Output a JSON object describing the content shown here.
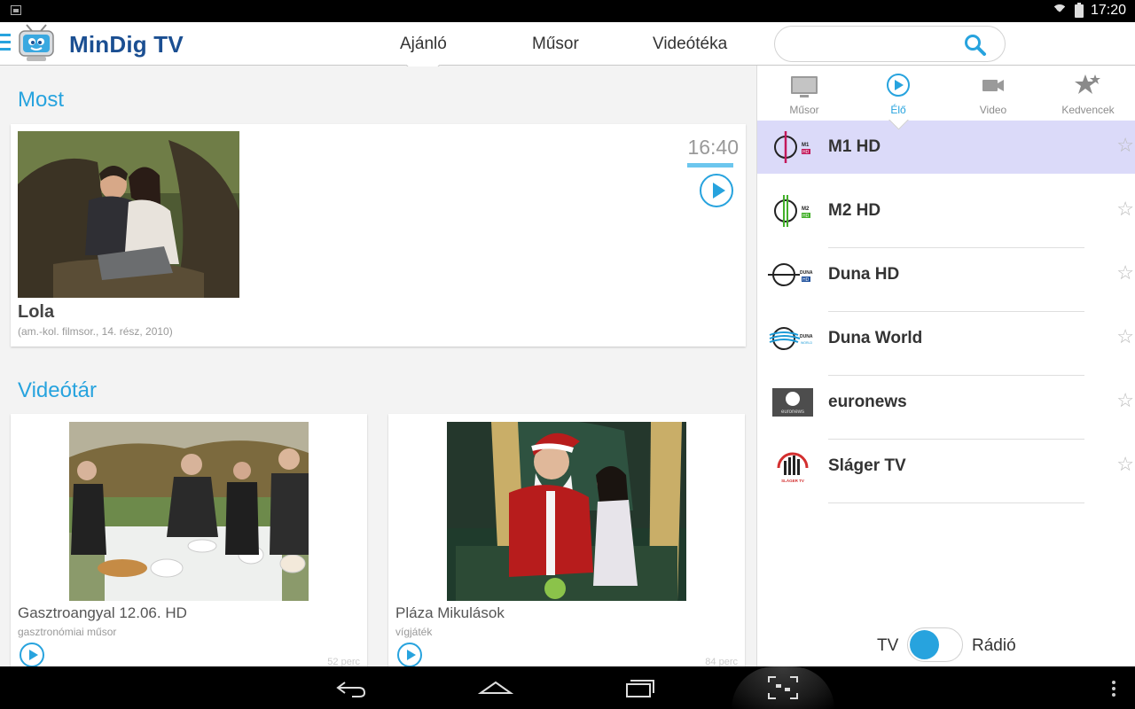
{
  "status_bar": {
    "time": "17:20"
  },
  "app": {
    "brand": "MinDig TV",
    "nav_tabs": [
      {
        "label": "Ajánló",
        "active": true
      },
      {
        "label": "Műsor",
        "active": false
      },
      {
        "label": "Videótéka",
        "active": false
      }
    ],
    "search": {
      "value": "",
      "placeholder": ""
    }
  },
  "main": {
    "now_section": {
      "title": "Most",
      "program": {
        "title": "Lola",
        "subtitle": "(am.-kol. filmsor., 14. rész, 2010)",
        "time": "16:40",
        "progress": 1.0
      }
    },
    "video_section": {
      "title": "Videótár",
      "items": [
        {
          "title": "Gasztroangyal 12.06. HD",
          "subtitle": "gasztronómiai műsor",
          "duration": "52 perc"
        },
        {
          "title": "Pláza Mikulások",
          "subtitle": "vígjáték",
          "duration": "84 perc"
        }
      ]
    }
  },
  "sidebar": {
    "tabs": [
      {
        "label": "Műsor",
        "icon": "tv-icon",
        "active": false
      },
      {
        "label": "Élő",
        "icon": "play-circle-icon",
        "active": true
      },
      {
        "label": "Video",
        "icon": "video-camera-icon",
        "active": false
      },
      {
        "label": "Kedvencek",
        "icon": "favorites-stars-icon",
        "active": false
      }
    ],
    "channels": [
      {
        "name": "M1 HD",
        "logo_text": "M1",
        "logo_sub": "HD",
        "logo_color": "#c2185b",
        "selected": true
      },
      {
        "name": "M2 HD",
        "logo_text": "M2",
        "logo_sub": "HD",
        "logo_color": "#43b02a",
        "selected": false
      },
      {
        "name": "Duna HD",
        "logo_text": "DUNA",
        "logo_sub": "HD",
        "logo_color": "#1d4f9c",
        "selected": false
      },
      {
        "name": "Duna World",
        "logo_text": "DUNA",
        "logo_sub": "WORLD",
        "logo_color": "#1d9bd7",
        "selected": false
      },
      {
        "name": "euronews",
        "logo_text": "euronews",
        "logo_sub": "",
        "logo_color": "#333333",
        "selected": false
      },
      {
        "name": "Sláger TV",
        "logo_text": "SLÁGER TV",
        "logo_sub": "",
        "logo_color": "#d32f2f",
        "selected": false
      }
    ],
    "toggle": {
      "left_label": "TV",
      "right_label": "Rádió",
      "value": "TV"
    }
  },
  "colors": {
    "accent": "#27a3de",
    "brand": "#1b4f92",
    "selected_row": "#dbdaf9"
  }
}
